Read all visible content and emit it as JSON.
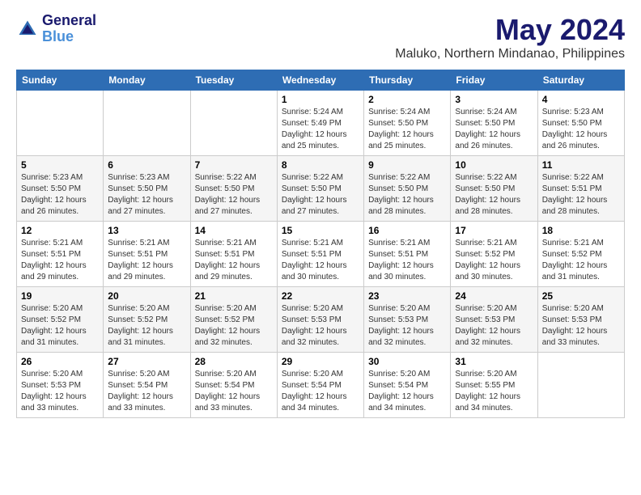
{
  "logo": {
    "line1": "General",
    "line2": "Blue"
  },
  "title": "May 2024",
  "subtitle": "Maluko, Northern Mindanao, Philippines",
  "days_of_week": [
    "Sunday",
    "Monday",
    "Tuesday",
    "Wednesday",
    "Thursday",
    "Friday",
    "Saturday"
  ],
  "weeks": [
    {
      "days": [
        {
          "number": "",
          "info": ""
        },
        {
          "number": "",
          "info": ""
        },
        {
          "number": "",
          "info": ""
        },
        {
          "number": "1",
          "info": "Sunrise: 5:24 AM\nSunset: 5:49 PM\nDaylight: 12 hours\nand 25 minutes."
        },
        {
          "number": "2",
          "info": "Sunrise: 5:24 AM\nSunset: 5:50 PM\nDaylight: 12 hours\nand 25 minutes."
        },
        {
          "number": "3",
          "info": "Sunrise: 5:24 AM\nSunset: 5:50 PM\nDaylight: 12 hours\nand 26 minutes."
        },
        {
          "number": "4",
          "info": "Sunrise: 5:23 AM\nSunset: 5:50 PM\nDaylight: 12 hours\nand 26 minutes."
        }
      ]
    },
    {
      "days": [
        {
          "number": "5",
          "info": "Sunrise: 5:23 AM\nSunset: 5:50 PM\nDaylight: 12 hours\nand 26 minutes."
        },
        {
          "number": "6",
          "info": "Sunrise: 5:23 AM\nSunset: 5:50 PM\nDaylight: 12 hours\nand 27 minutes."
        },
        {
          "number": "7",
          "info": "Sunrise: 5:22 AM\nSunset: 5:50 PM\nDaylight: 12 hours\nand 27 minutes."
        },
        {
          "number": "8",
          "info": "Sunrise: 5:22 AM\nSunset: 5:50 PM\nDaylight: 12 hours\nand 27 minutes."
        },
        {
          "number": "9",
          "info": "Sunrise: 5:22 AM\nSunset: 5:50 PM\nDaylight: 12 hours\nand 28 minutes."
        },
        {
          "number": "10",
          "info": "Sunrise: 5:22 AM\nSunset: 5:50 PM\nDaylight: 12 hours\nand 28 minutes."
        },
        {
          "number": "11",
          "info": "Sunrise: 5:22 AM\nSunset: 5:51 PM\nDaylight: 12 hours\nand 28 minutes."
        }
      ]
    },
    {
      "days": [
        {
          "number": "12",
          "info": "Sunrise: 5:21 AM\nSunset: 5:51 PM\nDaylight: 12 hours\nand 29 minutes."
        },
        {
          "number": "13",
          "info": "Sunrise: 5:21 AM\nSunset: 5:51 PM\nDaylight: 12 hours\nand 29 minutes."
        },
        {
          "number": "14",
          "info": "Sunrise: 5:21 AM\nSunset: 5:51 PM\nDaylight: 12 hours\nand 29 minutes."
        },
        {
          "number": "15",
          "info": "Sunrise: 5:21 AM\nSunset: 5:51 PM\nDaylight: 12 hours\nand 30 minutes."
        },
        {
          "number": "16",
          "info": "Sunrise: 5:21 AM\nSunset: 5:51 PM\nDaylight: 12 hours\nand 30 minutes."
        },
        {
          "number": "17",
          "info": "Sunrise: 5:21 AM\nSunset: 5:52 PM\nDaylight: 12 hours\nand 30 minutes."
        },
        {
          "number": "18",
          "info": "Sunrise: 5:21 AM\nSunset: 5:52 PM\nDaylight: 12 hours\nand 31 minutes."
        }
      ]
    },
    {
      "days": [
        {
          "number": "19",
          "info": "Sunrise: 5:20 AM\nSunset: 5:52 PM\nDaylight: 12 hours\nand 31 minutes."
        },
        {
          "number": "20",
          "info": "Sunrise: 5:20 AM\nSunset: 5:52 PM\nDaylight: 12 hours\nand 31 minutes."
        },
        {
          "number": "21",
          "info": "Sunrise: 5:20 AM\nSunset: 5:52 PM\nDaylight: 12 hours\nand 32 minutes."
        },
        {
          "number": "22",
          "info": "Sunrise: 5:20 AM\nSunset: 5:53 PM\nDaylight: 12 hours\nand 32 minutes."
        },
        {
          "number": "23",
          "info": "Sunrise: 5:20 AM\nSunset: 5:53 PM\nDaylight: 12 hours\nand 32 minutes."
        },
        {
          "number": "24",
          "info": "Sunrise: 5:20 AM\nSunset: 5:53 PM\nDaylight: 12 hours\nand 32 minutes."
        },
        {
          "number": "25",
          "info": "Sunrise: 5:20 AM\nSunset: 5:53 PM\nDaylight: 12 hours\nand 33 minutes."
        }
      ]
    },
    {
      "days": [
        {
          "number": "26",
          "info": "Sunrise: 5:20 AM\nSunset: 5:53 PM\nDaylight: 12 hours\nand 33 minutes."
        },
        {
          "number": "27",
          "info": "Sunrise: 5:20 AM\nSunset: 5:54 PM\nDaylight: 12 hours\nand 33 minutes."
        },
        {
          "number": "28",
          "info": "Sunrise: 5:20 AM\nSunset: 5:54 PM\nDaylight: 12 hours\nand 33 minutes."
        },
        {
          "number": "29",
          "info": "Sunrise: 5:20 AM\nSunset: 5:54 PM\nDaylight: 12 hours\nand 34 minutes."
        },
        {
          "number": "30",
          "info": "Sunrise: 5:20 AM\nSunset: 5:54 PM\nDaylight: 12 hours\nand 34 minutes."
        },
        {
          "number": "31",
          "info": "Sunrise: 5:20 AM\nSunset: 5:55 PM\nDaylight: 12 hours\nand 34 minutes."
        },
        {
          "number": "",
          "info": ""
        }
      ]
    }
  ]
}
